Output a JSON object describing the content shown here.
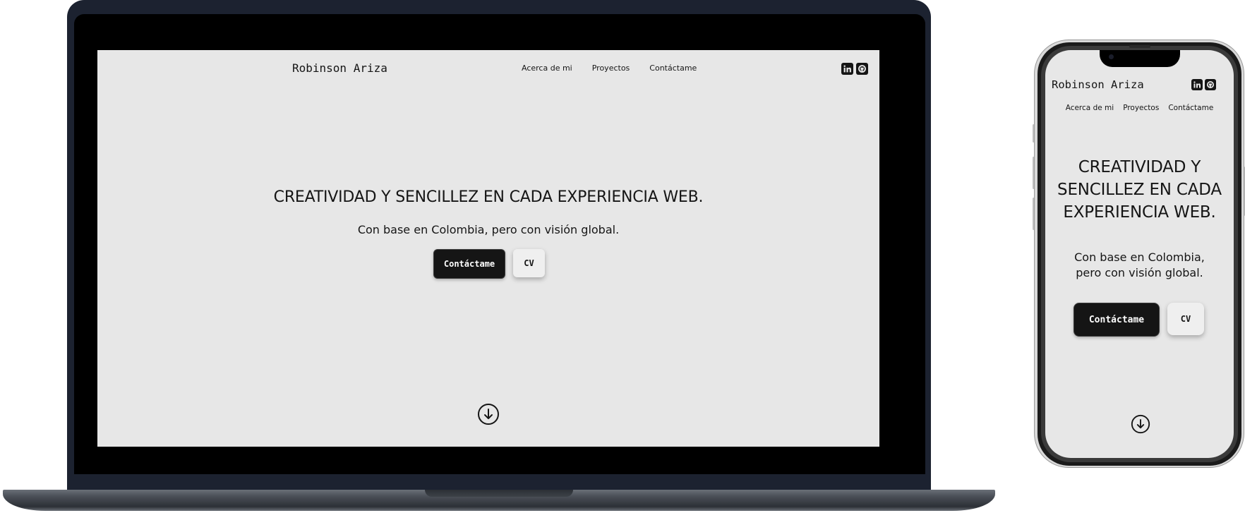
{
  "site": {
    "brand": "Robinson Ariza",
    "nav": [
      "Acerca de mi",
      "Proyectos",
      "Contáctame"
    ],
    "social_icons": [
      "linkedin-icon",
      "github-icon"
    ],
    "hero": {
      "title": "CREATIVIDAD Y SENCILLEZ EN CADA EXPERIENCIA WEB.",
      "subtitle": "Con base en Colombia, pero con visión global.",
      "primary_button": "Contáctame",
      "secondary_button": "CV"
    },
    "scroll_icon": "arrow-down-circle-icon"
  },
  "mobile": {
    "title_lines": [
      "CREATIVIDAD Y",
      "SENCILLEZ EN CADA",
      "EXPERIENCIA WEB."
    ],
    "subtitle_lines": [
      "Con base en Colombia,",
      "pero con visión global."
    ]
  },
  "colors": {
    "page_background": "#e7e7e7",
    "text": "#151515",
    "primary_button": "#151515",
    "laptop_frame": "#1c2230"
  }
}
